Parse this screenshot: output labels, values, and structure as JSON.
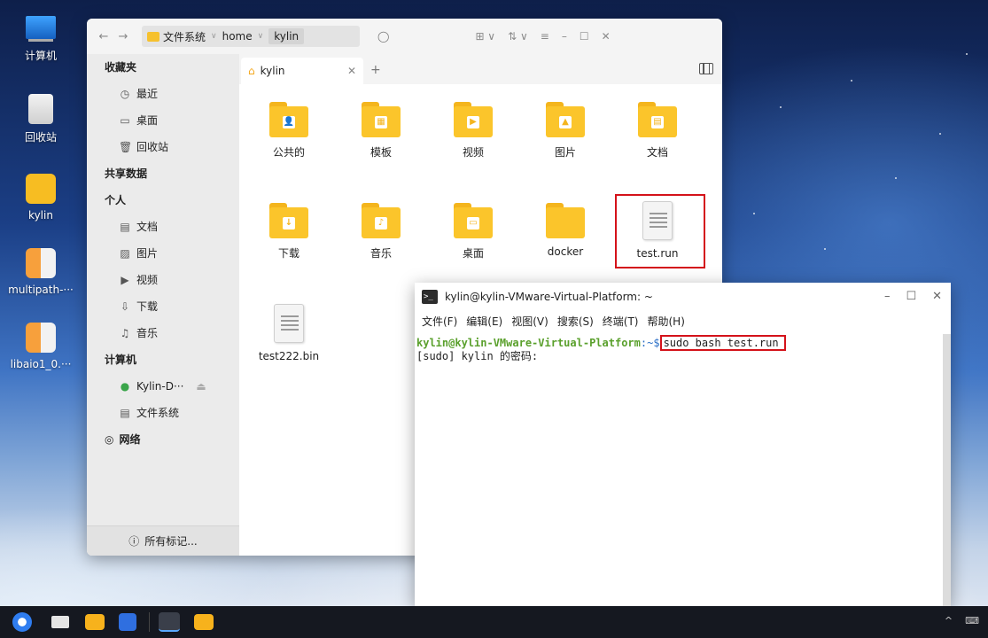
{
  "desktop": {
    "icons": [
      {
        "name": "desktop-icon-computer",
        "label": "计算机"
      },
      {
        "name": "desktop-icon-trash",
        "label": "回收站"
      },
      {
        "name": "desktop-icon-home",
        "label": "kylin"
      },
      {
        "name": "desktop-icon-multipath",
        "label": "multipath-···"
      },
      {
        "name": "desktop-icon-libaio",
        "label": "libaio1_0.···"
      }
    ]
  },
  "file_manager": {
    "nav": {
      "back": "←",
      "forward": "→"
    },
    "path": [
      "文件系统",
      "home",
      "kylin"
    ],
    "search_icon": "search-icon",
    "toolbar": {
      "view": "⊞ ∨",
      "sort": "⇅ ∨",
      "menu": "≡",
      "minimize": "–",
      "maximize": "☐",
      "close": "✕"
    },
    "sidebar": {
      "favorites_header": "收藏夹",
      "favorites": [
        {
          "icon": "◷",
          "label": "最近"
        },
        {
          "icon": "▭",
          "label": "桌面"
        },
        {
          "icon": "🗑",
          "label": "回收站"
        }
      ],
      "shared_header": "共享数据",
      "personal_header": "个人",
      "personal": [
        {
          "icon": "▤",
          "label": "文档"
        },
        {
          "icon": "▨",
          "label": "图片"
        },
        {
          "icon": "▶",
          "label": "视频"
        },
        {
          "icon": "⇩",
          "label": "下载"
        },
        {
          "icon": "♫",
          "label": "音乐"
        }
      ],
      "computer_header": "计算机",
      "computer": [
        {
          "icon": "●",
          "label": "Kylin-D···"
        },
        {
          "icon": "▤",
          "label": "文件系统"
        }
      ],
      "network": {
        "icon": "◎",
        "label": "网络"
      },
      "all_tags": "所有标记..."
    },
    "tab": {
      "label": "kylin",
      "close": "✕",
      "new": "+"
    },
    "files": [
      {
        "label": "公共的",
        "emblem": "👤"
      },
      {
        "label": "模板",
        "emblem": "▦"
      },
      {
        "label": "视频",
        "emblem": "▶"
      },
      {
        "label": "图片",
        "emblem": "▲"
      },
      {
        "label": "文档",
        "emblem": "▤"
      },
      {
        "label": "下载",
        "emblem": "↓"
      },
      {
        "label": "音乐",
        "emblem": "♪"
      },
      {
        "label": "桌面",
        "emblem": "▭"
      },
      {
        "label": "docker",
        "emblem": ""
      },
      {
        "label": "test.run",
        "emblem": "doc"
      },
      {
        "label": "test222.bin",
        "emblem": "doc"
      }
    ]
  },
  "terminal": {
    "title": "kylin@kylin-VMware-Virtual-Platform: ~",
    "menu": [
      "文件(F)",
      "编辑(E)",
      "视图(V)",
      "搜索(S)",
      "终端(T)",
      "帮助(H)"
    ],
    "controls": {
      "minimize": "–",
      "maximize": "☐",
      "close": "✕"
    },
    "prompt_user": "kylin@kylin-VMware-Virtual-Platform",
    "prompt_path": ":~$",
    "command": "sudo bash  test.run",
    "line2": "[sudo] kylin 的密码:"
  },
  "taskbar": {
    "items": [
      "start-menu-icon",
      "multitask-icon",
      "file-manager-icon",
      "wps-writer-icon",
      "terminal-icon",
      "file-manager-icon-2"
    ],
    "tray": {
      "up": "^",
      "keyboard": "⌨"
    }
  }
}
